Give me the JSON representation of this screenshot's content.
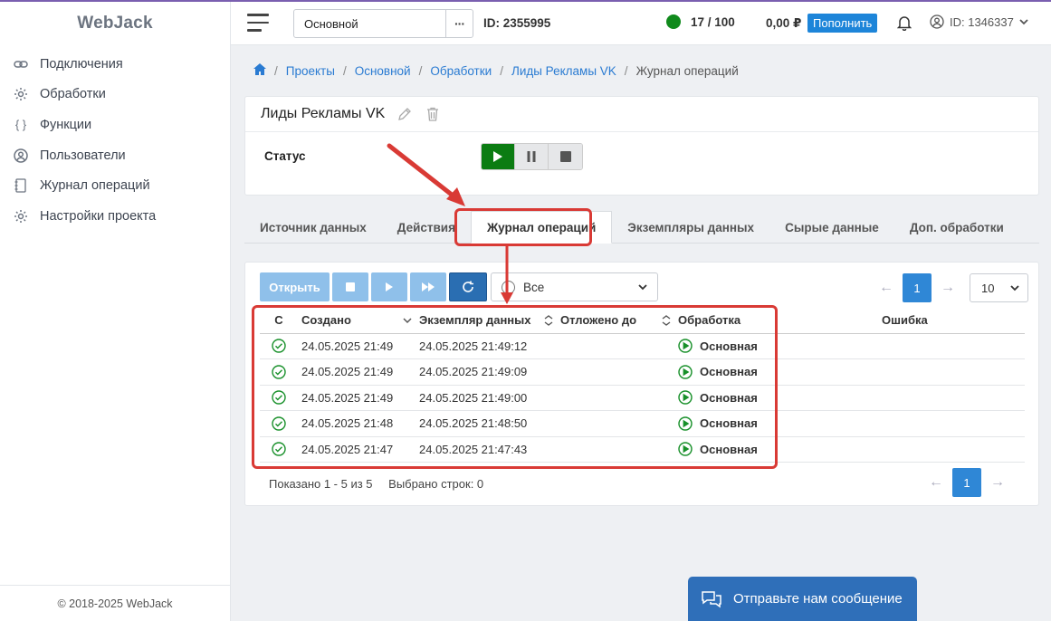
{
  "app": {
    "logo": "WebJack",
    "footer": "© 2018-2025 WebJack"
  },
  "sidebar": {
    "items": [
      {
        "label": "Подключения",
        "icon": "link-icon"
      },
      {
        "label": "Обработки",
        "icon": "gear-icon"
      },
      {
        "label": "Функции",
        "icon": "braces-icon"
      },
      {
        "label": "Пользователи",
        "icon": "user-icon"
      },
      {
        "label": "Журнал операций",
        "icon": "journal-icon"
      },
      {
        "label": "Настройки проекта",
        "icon": "gear-icon"
      }
    ]
  },
  "header": {
    "project": "Основной",
    "more": "···",
    "project_id": "ID: 2355995",
    "limits": "17 / 100",
    "balance": "0,00 ₽",
    "topup": "Пополнить",
    "user_id": "ID: 1346337"
  },
  "breadcrumb": {
    "items": [
      "Проекты",
      "Основной",
      "Обработки",
      "Лиды Рекламы VK"
    ],
    "current": "Журнал операций"
  },
  "processing": {
    "title": "Лиды Рекламы VK",
    "status_label": "Статус"
  },
  "tabs": [
    "Источник данных",
    "Действия",
    "Журнал операций",
    "Экземпляры данных",
    "Сырые данные",
    "Доп. обработки"
  ],
  "active_tab": "Журнал операций",
  "toolbar": {
    "open": "Открыть",
    "filter": "Все"
  },
  "pager": {
    "page": "1",
    "page_size": "10",
    "prev": "←",
    "next": "→"
  },
  "table": {
    "columns": [
      "С",
      "Создано",
      "Экземпляр данных",
      "Отложено до",
      "Обработка",
      "Ошибка"
    ],
    "rows": [
      {
        "created": "24.05.2025 21:49",
        "instance": "24.05.2025 21:49:12",
        "deferred": "",
        "processing": "Основная",
        "error": ""
      },
      {
        "created": "24.05.2025 21:49",
        "instance": "24.05.2025 21:49:09",
        "deferred": "",
        "processing": "Основная",
        "error": ""
      },
      {
        "created": "24.05.2025 21:49",
        "instance": "24.05.2025 21:49:00",
        "deferred": "",
        "processing": "Основная",
        "error": ""
      },
      {
        "created": "24.05.2025 21:48",
        "instance": "24.05.2025 21:48:50",
        "deferred": "",
        "processing": "Основная",
        "error": ""
      },
      {
        "created": "24.05.2025 21:47",
        "instance": "24.05.2025 21:47:43",
        "deferred": "",
        "processing": "Основная",
        "error": ""
      }
    ]
  },
  "footer": {
    "shown": "Показано 1 - 5 из 5",
    "selected": "Выбрано строк: 0"
  },
  "chat": {
    "label": "Отправьте нам сообщение"
  },
  "colors": {
    "accent": "#2f87d6",
    "play": "#0b7c12",
    "highlight": "#d93a35"
  }
}
